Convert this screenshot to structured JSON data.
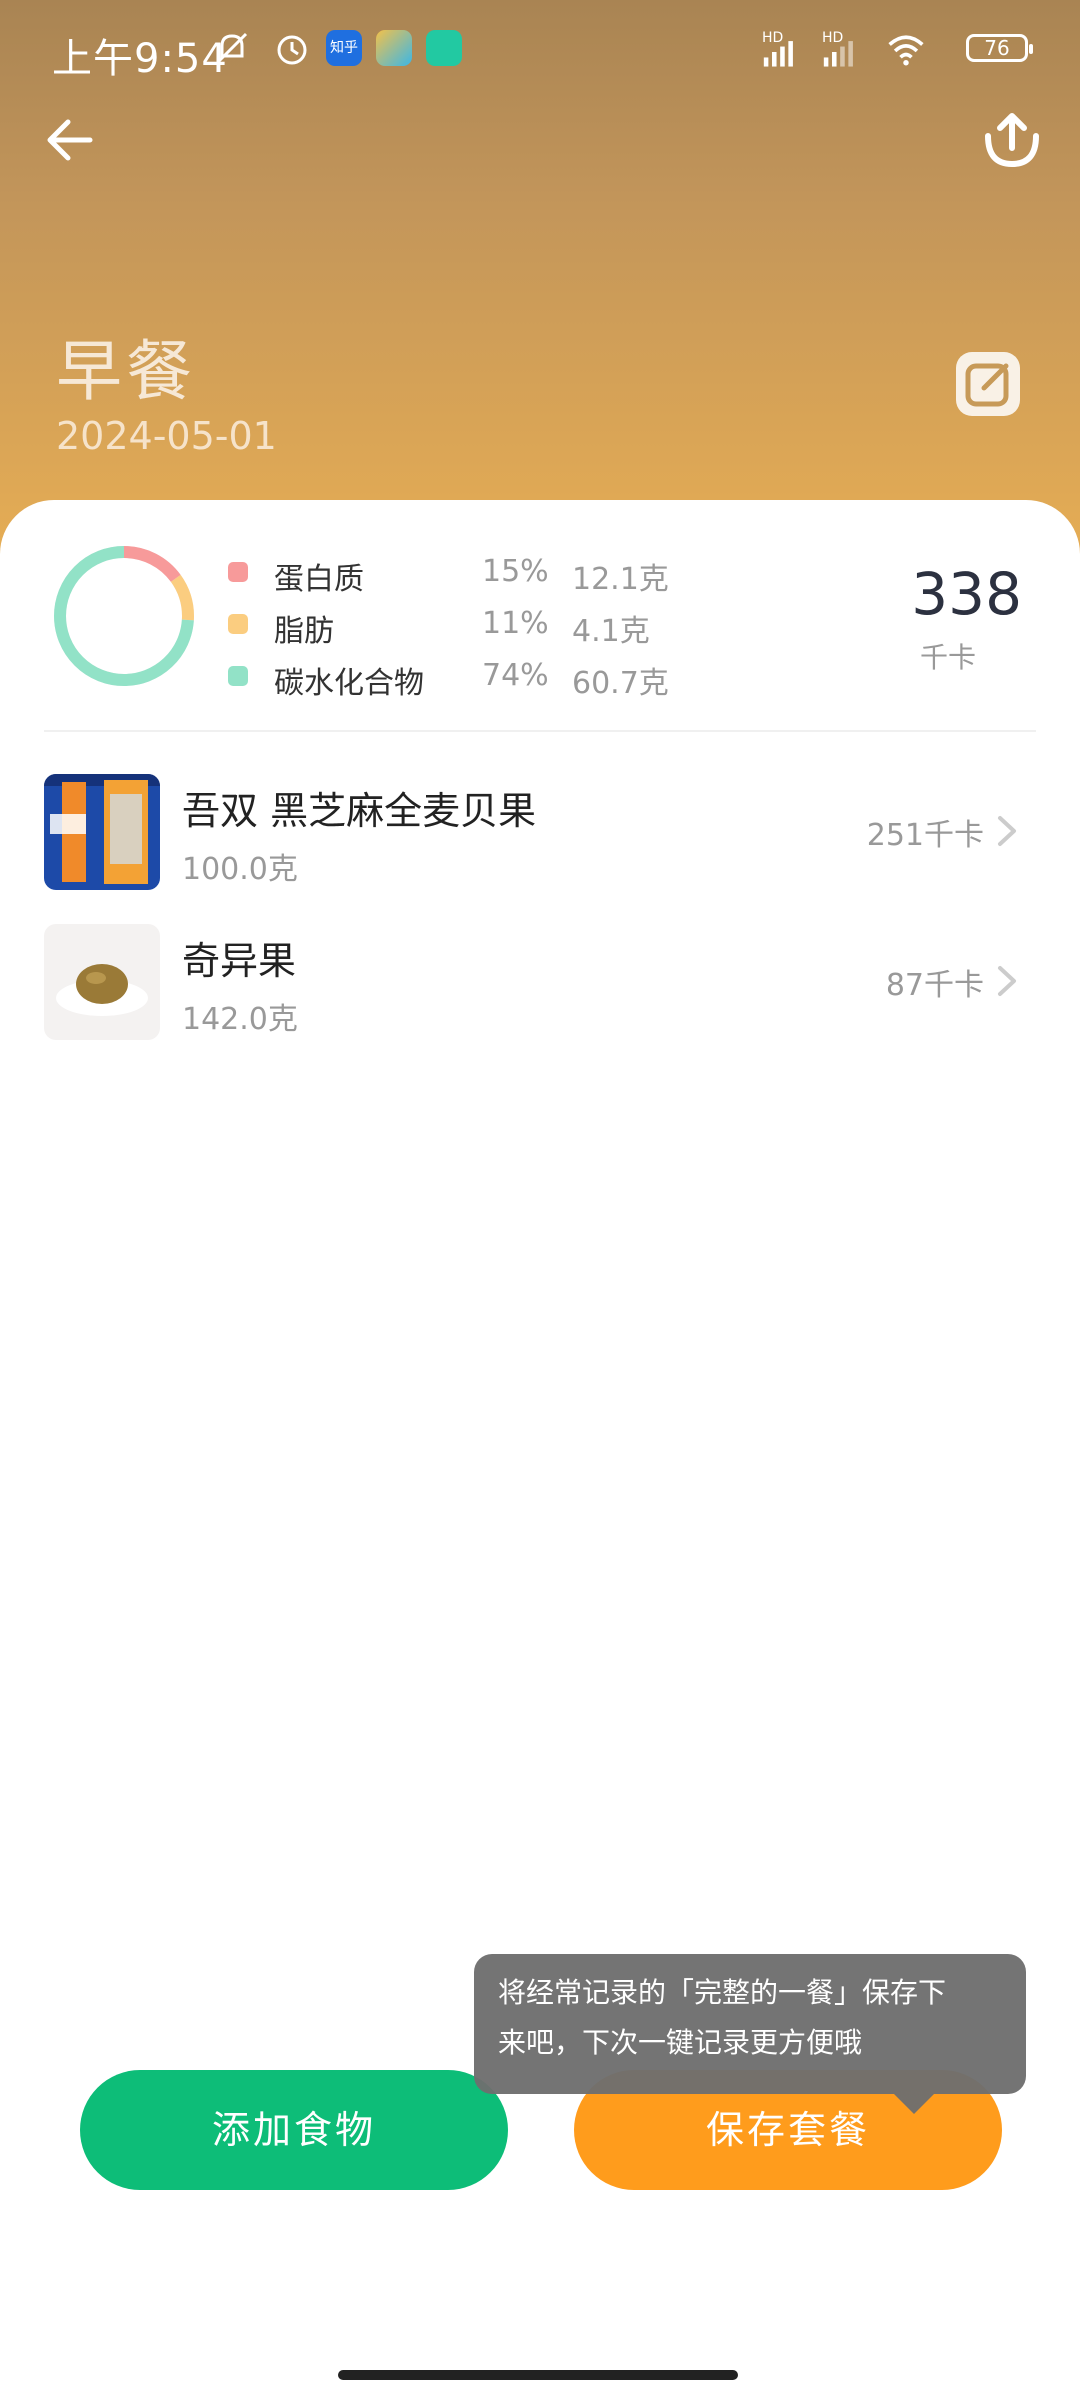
{
  "status_bar": {
    "time": "上午9:54",
    "app_icons": [
      "知乎",
      "feishu-icon",
      "mint-icon"
    ],
    "network_label_1": "HD",
    "network_label_2": "HD",
    "battery": "76"
  },
  "header": {
    "meal": "早餐",
    "date": "2024-05-01",
    "bg_colors": [
      "#a98453",
      "#e6ad54"
    ]
  },
  "summary": {
    "total_kcal": "338",
    "kcal_unit": "千卡",
    "nutrients": [
      {
        "name": "蛋白质",
        "percent": "15%",
        "amount": "12.1克",
        "color": "#f79a9a",
        "fraction": 0.15
      },
      {
        "name": "脂肪",
        "percent": "11%",
        "amount": "4.1克",
        "color": "#fbcd80",
        "fraction": 0.11
      },
      {
        "name": "碳水化合物",
        "percent": "74%",
        "amount": "60.7克",
        "color": "#92e2c7",
        "fraction": 0.74
      }
    ]
  },
  "foods": [
    {
      "name": "吾双 黑芝麻全麦贝果",
      "weight": "100.0克",
      "kcal": "251千卡"
    },
    {
      "name": "奇异果",
      "weight": "142.0克",
      "kcal": "87千卡"
    }
  ],
  "tooltip": {
    "line1": "将经常记录的「完整的一餐」保存下",
    "line2": "来吧，下次一键记录更方便哦"
  },
  "buttons": {
    "add_food": "添加食物",
    "save_meal": "保存套餐",
    "add_color": "#0dbd78",
    "save_color": "#ff9c1c"
  }
}
